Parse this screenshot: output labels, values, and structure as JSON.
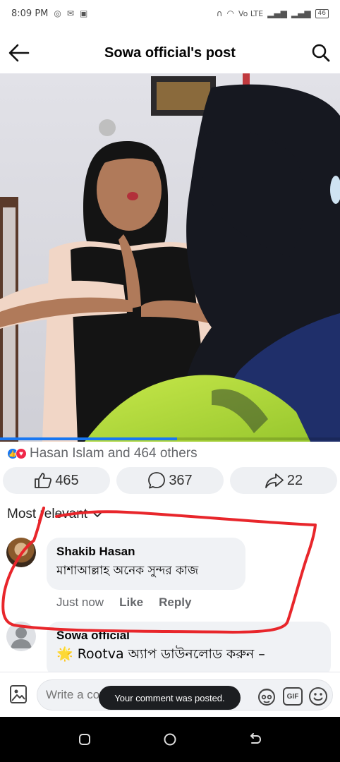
{
  "status_bar": {
    "time": "8:09 PM",
    "right_text": "Vo LTE",
    "battery": "46"
  },
  "header": {
    "title": "Sowa official's post",
    "back_icon": "arrow-left-icon",
    "search_icon": "search-icon"
  },
  "video": {
    "progress": 0.52,
    "accent": "#1877f2"
  },
  "reactions": {
    "summary": "Hasan Islam and 464 others"
  },
  "actions": {
    "like_count": "465",
    "comment_count": "367",
    "share_count": "22"
  },
  "comments": {
    "sort_label": "Most relevant",
    "items": [
      {
        "author": "Shakib Hasan",
        "text": "মাশাআল্লাহ অনেক সুন্দর কাজ",
        "time": "Just now",
        "like_label": "Like",
        "reply_label": "Reply"
      },
      {
        "author": "Sowa official",
        "text": "🌟 Rootva অ্যাপ ডাউনলোড করুন –"
      }
    ]
  },
  "composer": {
    "placeholder": "Write a comment…",
    "gif_label": "GIF"
  },
  "toast": {
    "message": "Your comment was posted."
  },
  "colors": {
    "annotation": "#e8262b",
    "like_blue": "#1877f2",
    "love_red": "#f02849"
  }
}
